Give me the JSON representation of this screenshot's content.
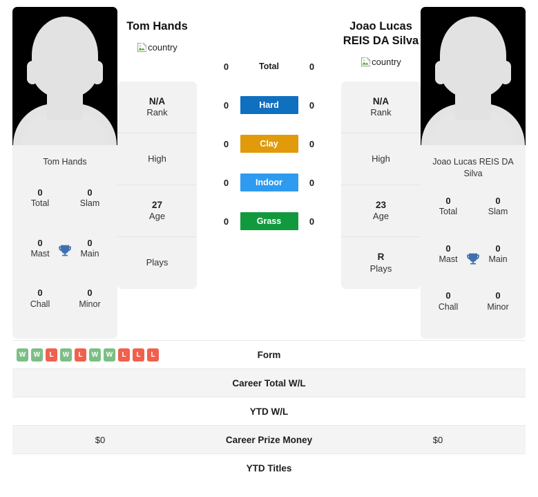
{
  "players": {
    "left": {
      "name": "Tom Hands",
      "name_wraps": false,
      "caption": "Tom Hands",
      "country_alt": "country",
      "rank": "N/A",
      "rank_label": "Rank",
      "high": "",
      "high_label": "High",
      "age": "27",
      "age_label": "Age",
      "plays": "",
      "plays_label": "Plays",
      "titles": [
        {
          "num": "0",
          "label": "Total"
        },
        {
          "num": "0",
          "label": "Slam"
        },
        {
          "num": "0",
          "label": "Mast"
        },
        {
          "num": "0",
          "label": "Main"
        },
        {
          "num": "0",
          "label": "Chall"
        },
        {
          "num": "0",
          "label": "Minor"
        }
      ]
    },
    "right": {
      "name": "Joao Lucas REIS DA Silva",
      "name_wraps": true,
      "caption": "Joao Lucas REIS DA Silva",
      "country_alt": "country",
      "rank": "N/A",
      "rank_label": "Rank",
      "high": "",
      "high_label": "High",
      "age": "23",
      "age_label": "Age",
      "plays": "R",
      "plays_label": "Plays",
      "titles": [
        {
          "num": "0",
          "label": "Total"
        },
        {
          "num": "0",
          "label": "Slam"
        },
        {
          "num": "0",
          "label": "Mast"
        },
        {
          "num": "0",
          "label": "Main"
        },
        {
          "num": "0",
          "label": "Chall"
        },
        {
          "num": "0",
          "label": "Minor"
        }
      ]
    }
  },
  "surfaces": [
    {
      "label": "Total",
      "left": "0",
      "right": "0",
      "color": "transparent",
      "plain": true
    },
    {
      "label": "Hard",
      "left": "0",
      "right": "0",
      "color": "#0f70c0",
      "plain": false
    },
    {
      "label": "Clay",
      "left": "0",
      "right": "0",
      "color": "#e09a0a",
      "plain": false
    },
    {
      "label": "Indoor",
      "left": "0",
      "right": "0",
      "color": "#2e9bf0",
      "plain": false
    },
    {
      "label": "Grass",
      "left": "0",
      "right": "0",
      "color": "#119a3d",
      "plain": false
    }
  ],
  "comparison_rows": [
    {
      "label": "Form",
      "left_text": "",
      "right_text": "",
      "type": "form",
      "alt": false
    },
    {
      "label": "Career Total W/L",
      "left_text": "",
      "right_text": "",
      "type": "text",
      "alt": true
    },
    {
      "label": "YTD W/L",
      "left_text": "",
      "right_text": "",
      "type": "text",
      "alt": false
    },
    {
      "label": "Career Prize Money",
      "left_text": "$0",
      "right_text": "$0",
      "type": "text",
      "alt": true
    },
    {
      "label": "YTD Titles",
      "left_text": "",
      "right_text": "",
      "type": "text",
      "alt": false
    }
  ],
  "form": {
    "left": [
      "W",
      "W",
      "L",
      "W",
      "L",
      "W",
      "W",
      "L",
      "L",
      "L"
    ],
    "right": [],
    "win_color": "#7cbf86",
    "loss_color": "#f0604d"
  },
  "icons": {
    "trophy": "🏆",
    "broken_image": "broken-image-icon"
  }
}
